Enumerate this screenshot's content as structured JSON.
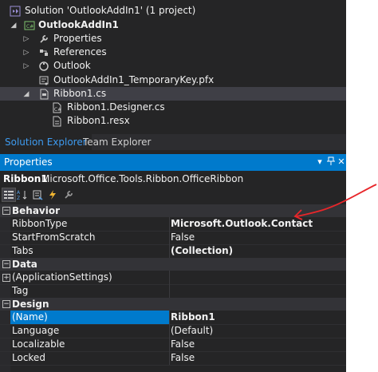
{
  "solution_explorer": {
    "items": [
      {
        "label": "Solution 'OutlookAddIn1' (1 project)",
        "bold": false,
        "icon": "solution-icon"
      },
      {
        "label": "OutlookAddIn1",
        "bold": true,
        "icon": "csharp-project-icon"
      },
      {
        "label": "Properties",
        "bold": false,
        "icon": "wrench-icon"
      },
      {
        "label": "References",
        "bold": false,
        "icon": "references-icon"
      },
      {
        "label": "Outlook",
        "bold": false,
        "icon": "outlook-folder-icon"
      },
      {
        "label": "OutlookAddIn1_TemporaryKey.pfx",
        "bold": false,
        "icon": "certificate-icon"
      },
      {
        "label": "Ribbon1.cs",
        "bold": false,
        "icon": "ribbon-file-icon"
      },
      {
        "label": "Ribbon1.Designer.cs",
        "bold": false,
        "icon": "code-file-icon"
      },
      {
        "label": "Ribbon1.resx",
        "bold": false,
        "icon": "resx-file-icon"
      }
    ]
  },
  "tabs": {
    "solution_explorer": "Solution Explorer",
    "team_explorer": "Team Explorer"
  },
  "properties": {
    "title": "Properties",
    "object_name": "Ribbon1",
    "object_type": "Microsoft.Office.Tools.Ribbon.OfficeRibbon",
    "toolbar": [
      "categorized-icon",
      "alphabetical-icon",
      "properties-page-icon",
      "events-icon",
      "property-pages-icon"
    ],
    "categories": [
      {
        "name": "Behavior",
        "rows": [
          {
            "name": "RibbonType",
            "value": "Microsoft.Outlook.Contact",
            "bold": true
          },
          {
            "name": "StartFromScratch",
            "value": "False",
            "bold": false
          },
          {
            "name": "Tabs",
            "value": "(Collection)",
            "bold": true
          }
        ]
      },
      {
        "name": "Data",
        "rows": [
          {
            "name": "(ApplicationSettings)",
            "value": "",
            "bold": false
          },
          {
            "name": "Tag",
            "value": "",
            "bold": false
          }
        ]
      },
      {
        "name": "Design",
        "rows": [
          {
            "name": "(Name)",
            "value": "Ribbon1",
            "bold": true
          },
          {
            "name": "Language",
            "value": "(Default)",
            "bold": false
          },
          {
            "name": "Localizable",
            "value": "False",
            "bold": false
          },
          {
            "name": "Locked",
            "value": "False",
            "bold": false
          }
        ]
      }
    ]
  },
  "colors": {
    "accent": "#007acc",
    "panel": "#252526",
    "annotation": "#e8262a"
  }
}
